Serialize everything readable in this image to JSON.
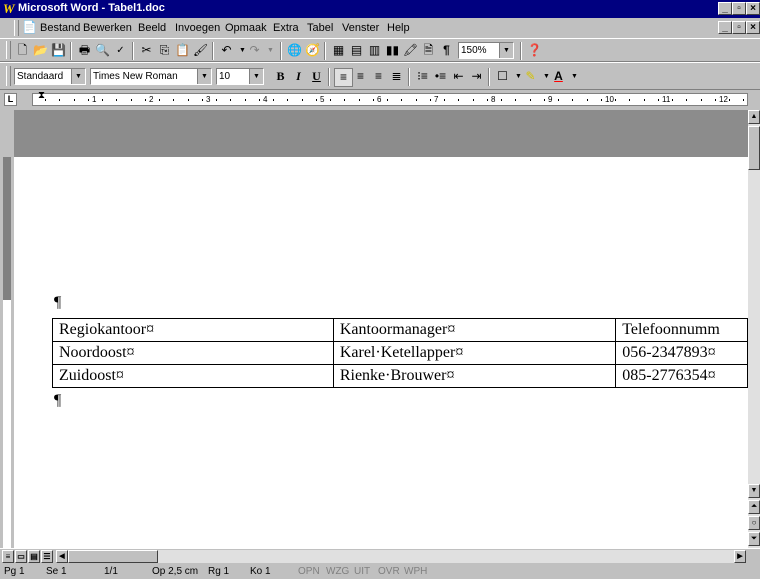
{
  "window": {
    "title": "Microsoft Word - Tabel1.doc",
    "app_icon": "W"
  },
  "menu": [
    "Bestand",
    "Bewerken",
    "Beeld",
    "Invoegen",
    "Opmaak",
    "Extra",
    "Tabel",
    "Venster",
    "Help"
  ],
  "toolbar": {
    "zoom": "150%"
  },
  "format": {
    "style": "Standaard",
    "font": "Times New Roman",
    "size": "10"
  },
  "ruler": {
    "labels": [
      "1",
      "2",
      "3",
      "4",
      "5",
      "6",
      "7",
      "8",
      "9",
      "10",
      "11",
      "12"
    ]
  },
  "document": {
    "table": {
      "rows": [
        [
          "Regiokantoor¤",
          "Kantoormanager¤",
          "Telefoonnumm"
        ],
        [
          "Noordoost¤",
          "Karel·Ketellapper¤",
          "056-2347893¤"
        ],
        [
          "Zuidoost¤",
          "Rienke·Brouwer¤",
          "085-2776354¤"
        ]
      ]
    },
    "pilcrow": "¶"
  },
  "status": {
    "page": "Pg 1",
    "section": "Se 1",
    "pages": "1/1",
    "position": "Op 2,5 cm",
    "line": "Rg 1",
    "column": "Ko 1",
    "modes": [
      "OPN",
      "WZG",
      "UIT",
      "OVR",
      "WPH"
    ]
  }
}
